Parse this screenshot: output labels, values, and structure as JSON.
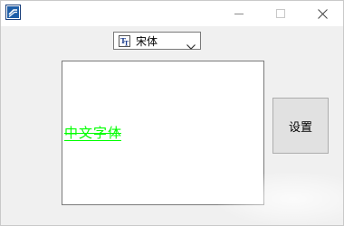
{
  "window": {
    "icon": "app-icon",
    "caption_buttons": [
      "minimize-icon",
      "maximize-icon",
      "close-icon"
    ]
  },
  "font_selector": {
    "icon": "truetype-font-icon",
    "selected": "宋体",
    "dropdown_icon": "chevron-down-icon"
  },
  "preview": {
    "text": "中文字体",
    "color": "#00ff00",
    "strikeout": true,
    "underline": true
  },
  "settings_button": {
    "label": "设置"
  },
  "colors": {
    "titlebar": "#ffffff",
    "background": "#f0f0f0",
    "preview_text": "#00ff00",
    "button_face": "#e1e1e1"
  }
}
